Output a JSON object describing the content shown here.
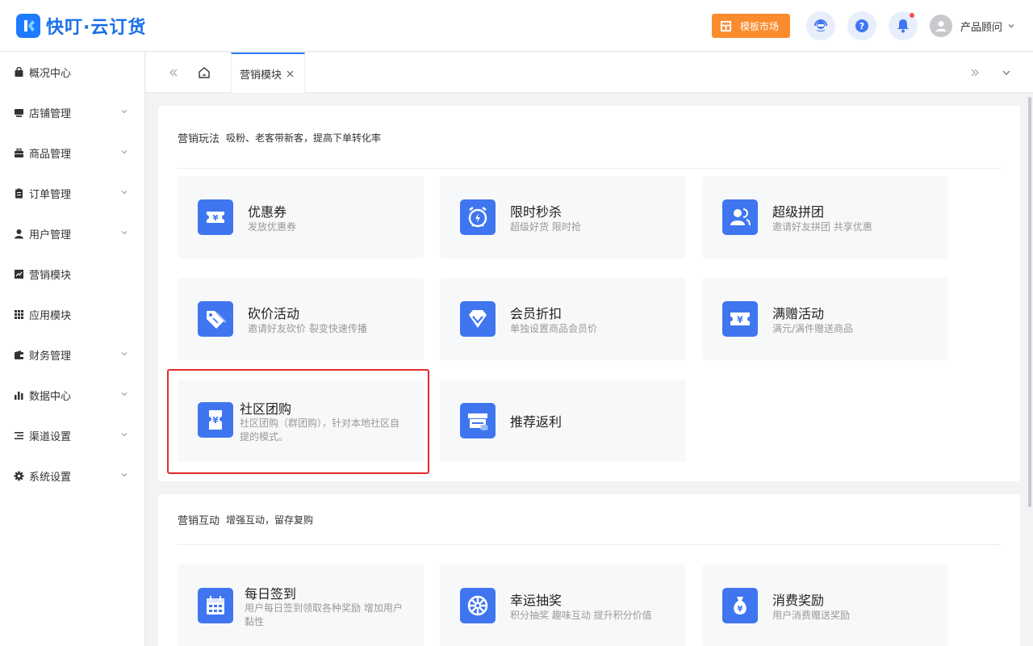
{
  "header": {
    "brand": "快叮·云订货",
    "market_label": "模板市场",
    "user_name": "产品顾问"
  },
  "sidebar": {
    "items": [
      {
        "label": "概况中心",
        "icon": "bag-icon",
        "has_caret": false
      },
      {
        "label": "店铺管理",
        "icon": "store-icon",
        "has_caret": true
      },
      {
        "label": "商品管理",
        "icon": "briefcase-icon",
        "has_caret": true
      },
      {
        "label": "订单管理",
        "icon": "clipboard-icon",
        "has_caret": true
      },
      {
        "label": "用户管理",
        "icon": "user-icon",
        "has_caret": true
      },
      {
        "label": "营销模块",
        "icon": "trend-chart-icon",
        "has_caret": false
      },
      {
        "label": "应用模块",
        "icon": "grid-icon",
        "has_caret": false
      },
      {
        "label": "财务管理",
        "icon": "wallet-icon",
        "has_caret": true
      },
      {
        "label": "数据中心",
        "icon": "bar-chart-icon",
        "has_caret": true
      },
      {
        "label": "渠道设置",
        "icon": "list-icon",
        "has_caret": true
      },
      {
        "label": "系统设置",
        "icon": "gear-icon",
        "has_caret": true
      }
    ]
  },
  "tabs": {
    "active_label": "营销模块"
  },
  "sections": [
    {
      "title": "营销玩法",
      "subtitle": "吸粉、老客带新客，提高下单转化率",
      "tiles": [
        {
          "title": "优惠券",
          "desc": "发放优惠券",
          "icon": "coupon-icon"
        },
        {
          "title": "限时秒杀",
          "desc": "超级好货 限时抢",
          "icon": "alarm-clock-icon"
        },
        {
          "title": "超级拼团",
          "desc": "邀请好友拼团 共享优惠",
          "icon": "group-users-icon"
        },
        {
          "title": "砍价活动",
          "desc": "邀请好友砍价 裂变快速传播",
          "icon": "price-tag-icon"
        },
        {
          "title": "会员折扣",
          "desc": "单独设置商品会员价",
          "icon": "diamond-icon"
        },
        {
          "title": "满赠活动",
          "desc": "满元/满件赠送商品",
          "icon": "gift-ticket-icon"
        },
        {
          "title": "社区团购",
          "desc": "社区团购（群团购），针对本地社区自提的模式。",
          "icon": "community-ticket-icon"
        },
        {
          "title": "推荐返利",
          "desc": "",
          "icon": "shop-coins-icon"
        }
      ]
    },
    {
      "title": "营销互动",
      "subtitle": "增强互动，留存复购",
      "tiles": [
        {
          "title": "每日签到",
          "desc": "用户每日签到领取各种奖励 增加用户黏性",
          "icon": "calendar-icon"
        },
        {
          "title": "幸运抽奖",
          "desc": "积分抽奖 趣味互动 提升积分价值",
          "icon": "lucky-wheel-icon"
        },
        {
          "title": "消费奖励",
          "desc": "用户消费赠送奖励",
          "icon": "money-bag-icon"
        }
      ]
    }
  ],
  "colors": {
    "primary": "#3f76f0",
    "accent_orange": "#fb8c2e",
    "highlight_red": "#e22b2b"
  }
}
